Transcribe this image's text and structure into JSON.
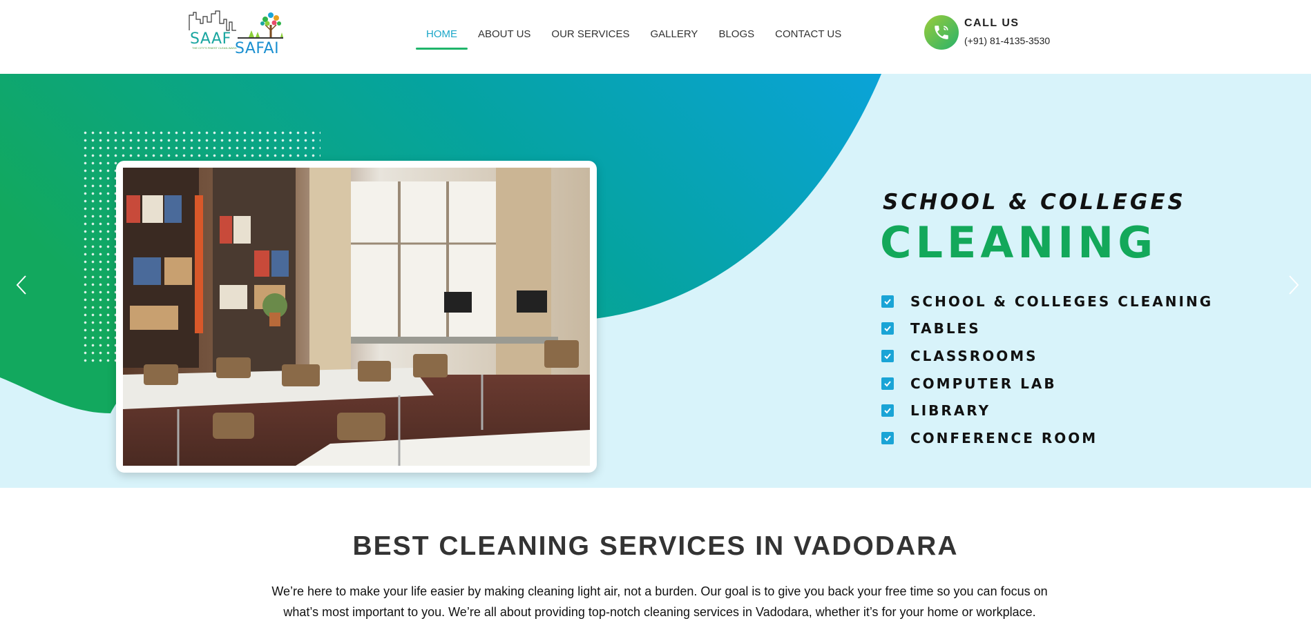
{
  "header": {
    "logo": {
      "primary": "SAAF",
      "secondary": "SAFAI",
      "tagline": "THE CITY'S FINEST CLEAN-WASH"
    },
    "nav": [
      {
        "label": "HOME",
        "active": true
      },
      {
        "label": "ABOUT US",
        "active": false
      },
      {
        "label": "OUR SERVICES",
        "active": false
      },
      {
        "label": "GALLERY",
        "active": false
      },
      {
        "label": "BLOGS",
        "active": false
      },
      {
        "label": "CONTACT US",
        "active": false
      }
    ],
    "call": {
      "title": "CALL US",
      "number": "(+91) 81-4135-3530",
      "icon": "phone-icon"
    }
  },
  "hero": {
    "subtitle": "SCHOOL & COLLEGES",
    "title": "CLEANING",
    "list": [
      "SCHOOL & COLLEGES CLEANING",
      "TABLES",
      "CLASSROOMS",
      "COMPUTER LAB",
      "LIBRARY",
      "CONFERENCE ROOM"
    ],
    "image": "classroom-photo",
    "prev_icon": "chevron-left-icon",
    "next_icon": "chevron-right-icon"
  },
  "content": {
    "title": "BEST CLEANING SERVICES IN VADODARA",
    "text": "We’re here to make your life easier by making cleaning light air, not a burden. Our goal is to give you back your free time so you can focus on what’s most important to you. We’re all about providing top-notch cleaning services in Vadodara, whether it’s for your home or workplace."
  },
  "colors": {
    "accent_green": "#13a85a",
    "accent_blue": "#1aa4d6",
    "hero_bg": "#d8f3fa"
  }
}
